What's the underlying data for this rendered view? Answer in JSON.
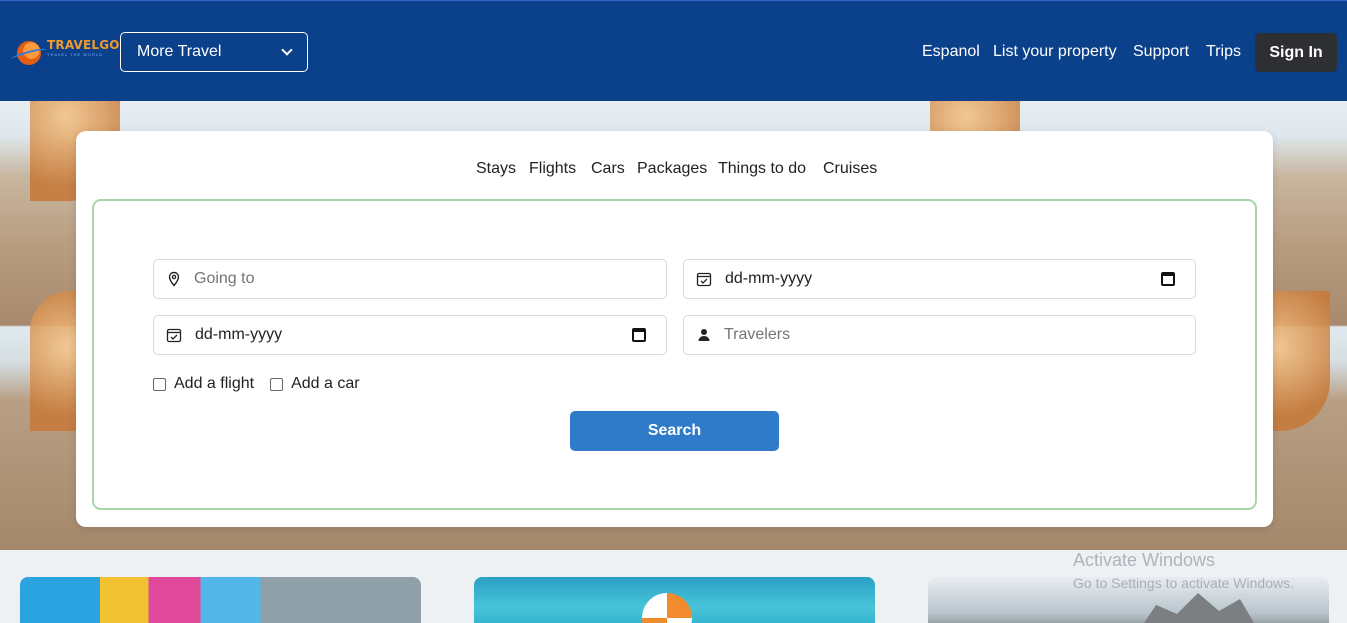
{
  "brand": {
    "name": "TRAVELGO",
    "tagline": "TRAVEL THE WORLD"
  },
  "header": {
    "more_travel": "More Travel",
    "nav": [
      "Espanol",
      "List your property",
      "Support",
      "Trips"
    ],
    "sign_in": "Sign In"
  },
  "tabs": [
    "Stays",
    "Flights",
    "Cars",
    "Packages",
    "Things to do",
    "Cruises"
  ],
  "form": {
    "destination_placeholder": "Going to",
    "checkin_value": "dd-mm-yyyy",
    "checkout_value": "dd-mm-yyyy",
    "travelers_placeholder": "Travelers",
    "add_flight": "Add a flight",
    "add_car": "Add a car",
    "search": "Search"
  },
  "watermark": {
    "line1": "Activate Windows",
    "line2": "Go to Settings to activate Windows."
  },
  "colors": {
    "header_bg": "#0b418a",
    "search_button": "#2f7bc9",
    "sign_in_bg": "#2d2f33",
    "panel_border": "#a8d5a8"
  }
}
